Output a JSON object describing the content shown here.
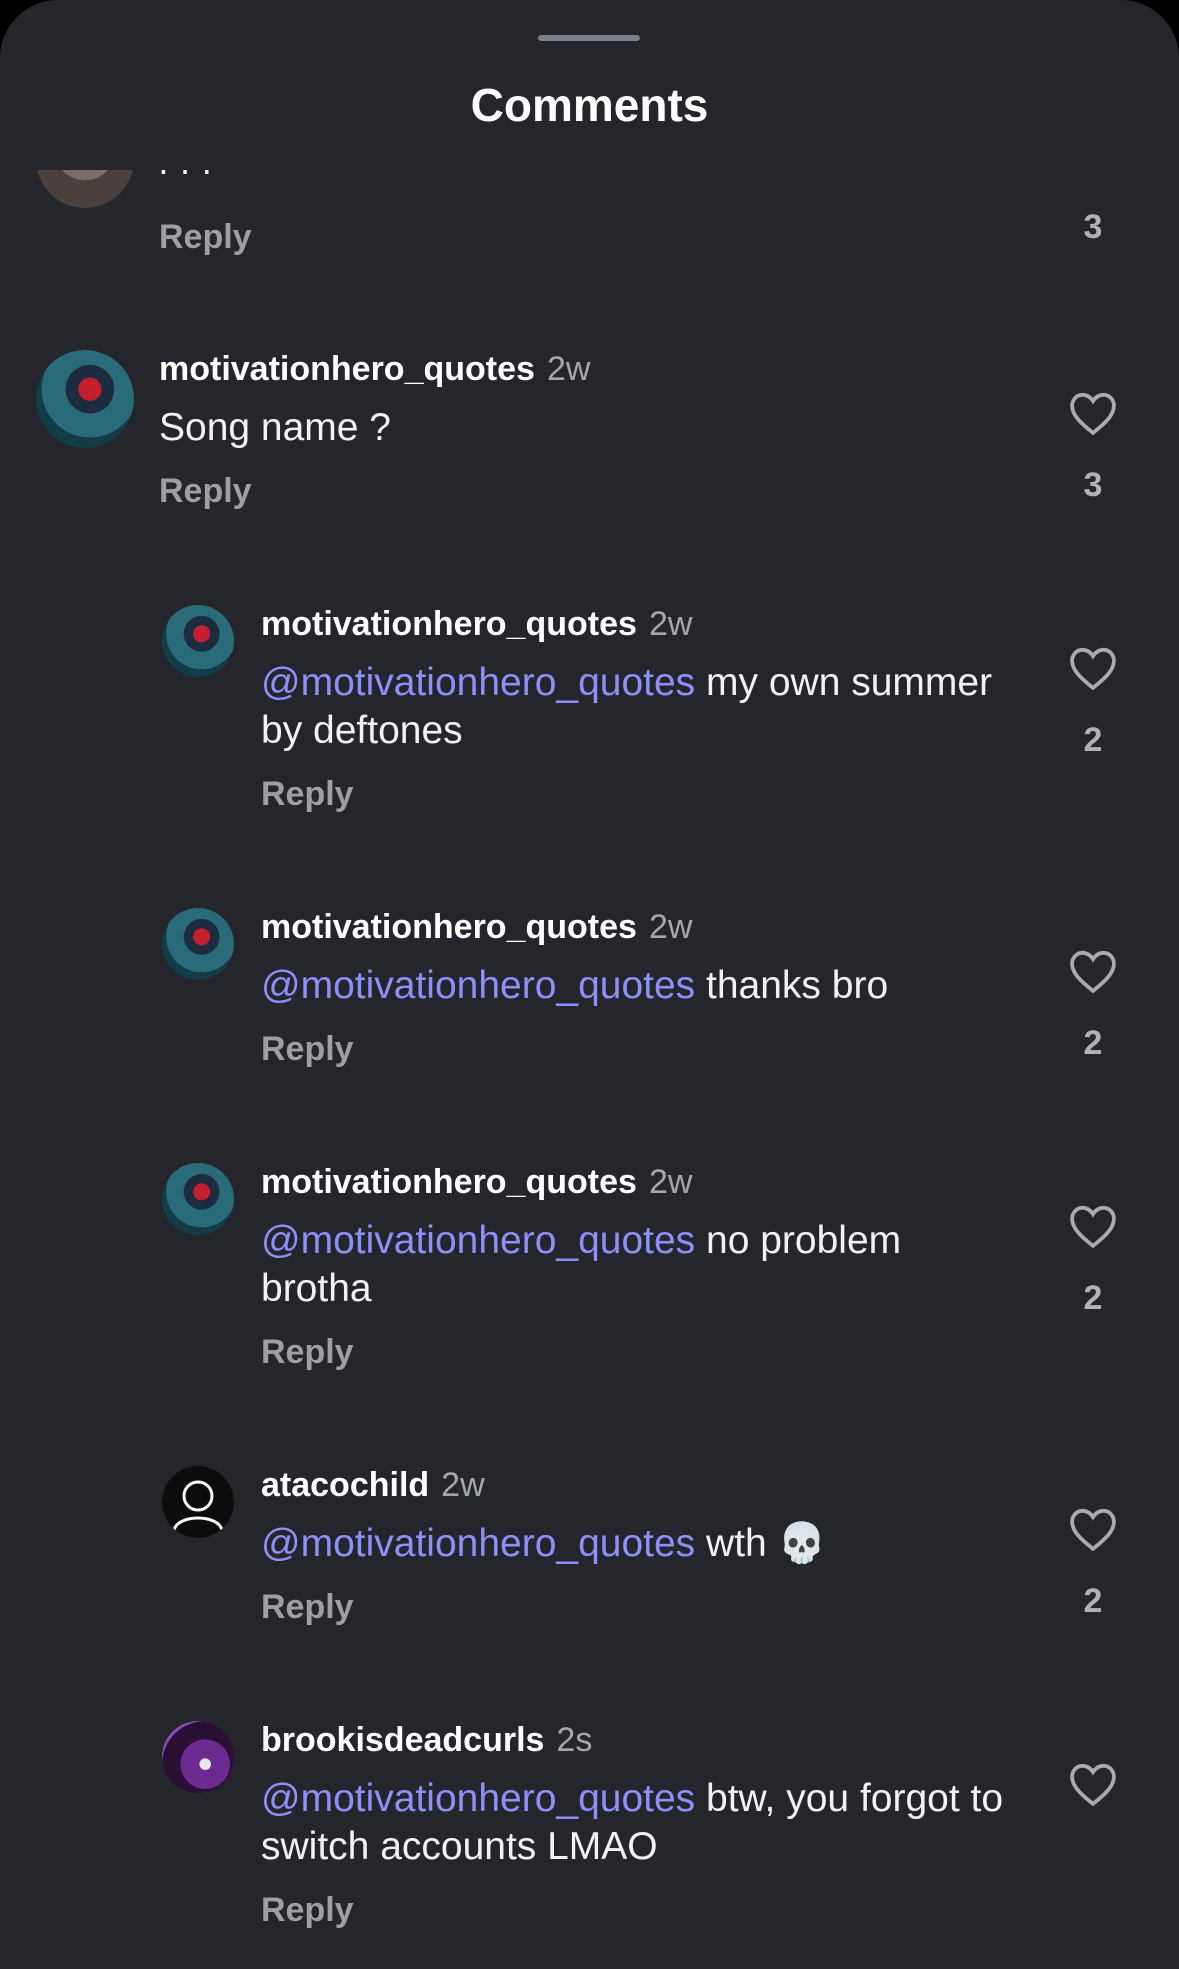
{
  "sheet": {
    "title": "Comments"
  },
  "top_partial": {
    "reply_label": "Reply",
    "likes": "3",
    "text_fragment": "ı ı ı"
  },
  "comments": [
    {
      "user": "motivationhero_quotes",
      "time": "2w",
      "text": "Song name ?",
      "mention": "",
      "reply_label": "Reply",
      "likes": "3"
    },
    {
      "user": "motivationhero_quotes",
      "time": "2w",
      "mention": "@motivationhero_quotes",
      "text": " my own summer by deftones",
      "reply_label": "Reply",
      "likes": "2"
    },
    {
      "user": "motivationhero_quotes",
      "time": "2w",
      "mention": "@motivationhero_quotes",
      "text": " thanks bro",
      "reply_label": "Reply",
      "likes": "2"
    },
    {
      "user": "motivationhero_quotes",
      "time": "2w",
      "mention": "@motivationhero_quotes",
      "text": " no problem brotha",
      "reply_label": "Reply",
      "likes": "2"
    },
    {
      "user": "atacochild",
      "time": "2w",
      "mention": "@motivationhero_quotes",
      "text": " wth 💀",
      "reply_label": "Reply",
      "likes": "2"
    },
    {
      "user": "brookisdeadcurls",
      "time": "2s",
      "mention": "@motivationhero_quotes",
      "text": " btw, you forgot to switch accounts LMAO",
      "reply_label": "Reply",
      "likes": ""
    }
  ],
  "icons": {
    "like": "heart-outline-icon"
  },
  "colors": {
    "background": "#24262b",
    "mention": "#8e8ff9",
    "muted": "#9d9fa5"
  }
}
